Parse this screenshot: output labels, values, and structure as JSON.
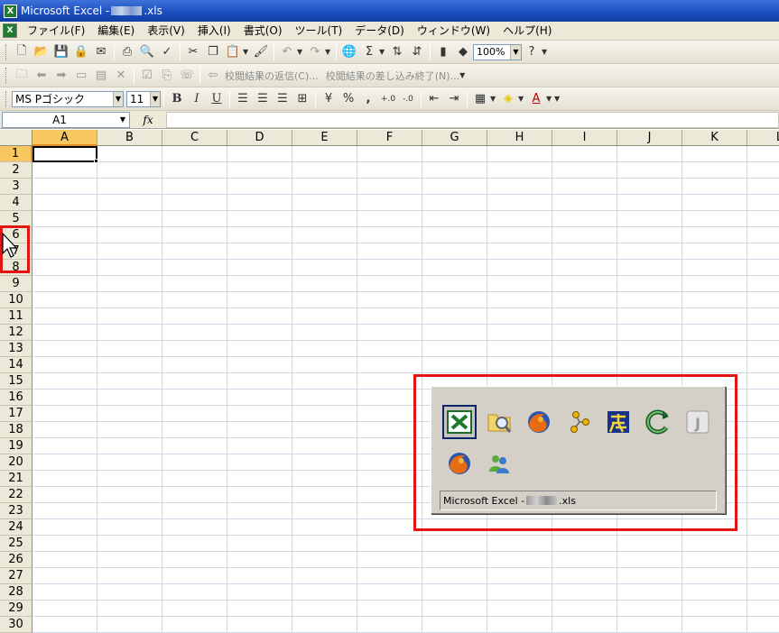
{
  "window": {
    "title_prefix": "Microsoft Excel -",
    "title_suffix": ".xls"
  },
  "menu": {
    "items": [
      "ファイル(F)",
      "編集(E)",
      "表示(V)",
      "挿入(I)",
      "書式(O)",
      "ツール(T)",
      "データ(D)",
      "ウィンドウ(W)",
      "ヘルプ(H)"
    ]
  },
  "toolbar": {
    "zoom": "100%",
    "review_reply": "校閲結果の返信(C)...",
    "review_end": "校閲結果の差し込み終了(N)..."
  },
  "format": {
    "font_name": "MS Pゴシック",
    "font_size": "11",
    "bold": "B",
    "italic": "I",
    "underline": "U",
    "percent": "%",
    "comma": ","
  },
  "formula_bar": {
    "name_box": "A1",
    "fx_label": "fx"
  },
  "sheet": {
    "columns": [
      "A",
      "B",
      "C",
      "D",
      "E",
      "F",
      "G",
      "H",
      "I",
      "J",
      "K",
      "L"
    ],
    "rows": [
      "1",
      "2",
      "3",
      "4",
      "5",
      "6",
      "7",
      "8",
      "9",
      "10",
      "11",
      "12",
      "13",
      "14",
      "15",
      "16",
      "17",
      "18",
      "19",
      "20",
      "21",
      "22",
      "23",
      "24",
      "25",
      "26",
      "27",
      "28",
      "29",
      "30"
    ],
    "selected_cell": "A1"
  },
  "switcher": {
    "label_prefix": "Microsoft Excel -",
    "label_suffix": ".xls",
    "icons": [
      "excel-icon",
      "image-viewer-icon",
      "firefox-icon",
      "molecule-icon",
      "kanji-app-icon",
      "refresh-app-icon",
      "java-icon",
      "firefox-icon",
      "messenger-icon"
    ]
  },
  "colors": {
    "highlight": "#e41414",
    "title_bar": "#1c4fc0",
    "header_selected": "#f8c860"
  }
}
